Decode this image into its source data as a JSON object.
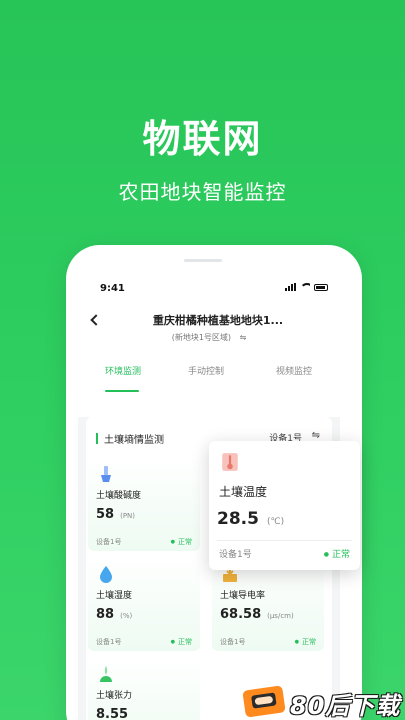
{
  "hero": {
    "title": "物联网",
    "subtitle": "农田地块智能监控"
  },
  "status_bar": {
    "time": "9:41"
  },
  "nav": {
    "title": "重庆柑橘种植基地地块1...",
    "subtitle": "(新地块1号区域)",
    "swap_icon": "⇋"
  },
  "tabs": [
    {
      "label": "环境监测",
      "active": true
    },
    {
      "label": "手动控制",
      "active": false
    },
    {
      "label": "视频监控",
      "active": false
    }
  ],
  "panel": {
    "title": "土壤墒情监测",
    "device": "设备1号",
    "swap_icon": "⇋"
  },
  "sensors": [
    {
      "icon": "ph-icon",
      "label": "土壤酸碱度",
      "value": "58",
      "unit": "(PN)",
      "device": "设备1号",
      "status": "正常",
      "color": "#5b8def"
    },
    {
      "icon": "thermometer-icon",
      "label": "土壤温度",
      "value": "28.5",
      "unit": "(℃)",
      "device": "设备1号",
      "status": "正常",
      "color": "#e8786a"
    },
    {
      "icon": "droplet-icon",
      "label": "土壤湿度",
      "value": "88",
      "unit": "(%)",
      "device": "设备1号",
      "status": "正常",
      "color": "#46a6ee"
    },
    {
      "icon": "conductivity-icon",
      "label": "土壤导电率",
      "value": "68.58",
      "unit": "(μs/cm)",
      "device": "设备1号",
      "status": "正常",
      "color": "#f2b23a"
    },
    {
      "icon": "tension-icon",
      "label": "土壤张力",
      "value": "8.55",
      "unit": "",
      "device": "",
      "status": "",
      "color": "#39c464"
    }
  ],
  "watermark": {
    "text": "80后下载"
  },
  "colors": {
    "brand_green": "#23c05a",
    "background_green": "#2fcf61"
  }
}
